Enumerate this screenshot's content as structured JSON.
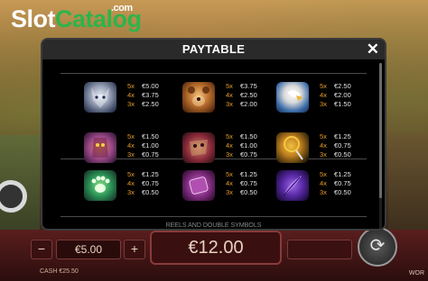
{
  "watermark": {
    "slot": "Slot",
    "catalog": "Catalog",
    "com": ".com"
  },
  "modal": {
    "title": "PAYTABLE",
    "close_label": "✕",
    "footer_text": "REELS AND DOUBLE SYMBOLS"
  },
  "symbols": [
    {
      "icon": "wolf-icon",
      "pays": [
        {
          "mult": "5x",
          "amount": "€5.00"
        },
        {
          "mult": "4x",
          "amount": "€3.75"
        },
        {
          "mult": "3x",
          "amount": "€2.50"
        }
      ]
    },
    {
      "icon": "bear-icon",
      "pays": [
        {
          "mult": "5x",
          "amount": "€3.75"
        },
        {
          "mult": "4x",
          "amount": "€2.50"
        },
        {
          "mult": "3x",
          "amount": "€2.00"
        }
      ]
    },
    {
      "icon": "eagle-icon",
      "pays": [
        {
          "mult": "5x",
          "amount": "€2.50"
        },
        {
          "mult": "4x",
          "amount": "€2.00"
        },
        {
          "mult": "3x",
          "amount": "€1.50"
        }
      ]
    },
    {
      "icon": "totem-icon",
      "pays": [
        {
          "mult": "5x",
          "amount": "€1.50"
        },
        {
          "mult": "4x",
          "amount": "€1.00"
        },
        {
          "mult": "3x",
          "amount": "€0.75"
        }
      ]
    },
    {
      "icon": "mask-icon",
      "pays": [
        {
          "mult": "5x",
          "amount": "€1.50"
        },
        {
          "mult": "4x",
          "amount": "€1.00"
        },
        {
          "mult": "3x",
          "amount": "€0.75"
        }
      ]
    },
    {
      "icon": "dreamcatcher-icon",
      "pays": [
        {
          "mult": "5x",
          "amount": "€1.25"
        },
        {
          "mult": "4x",
          "amount": "€0.75"
        },
        {
          "mult": "3x",
          "amount": "€0.50"
        }
      ]
    },
    {
      "icon": "paw-icon",
      "pays": [
        {
          "mult": "5x",
          "amount": "€1.25"
        },
        {
          "mult": "4x",
          "amount": "€0.75"
        },
        {
          "mult": "3x",
          "amount": "€0.50"
        }
      ]
    },
    {
      "icon": "drum-icon",
      "pays": [
        {
          "mult": "5x",
          "amount": "€1.25"
        },
        {
          "mult": "4x",
          "amount": "€0.75"
        },
        {
          "mult": "3x",
          "amount": "€0.50"
        }
      ]
    },
    {
      "icon": "feather-icon",
      "pays": [
        {
          "mult": "5x",
          "amount": "€1.25"
        },
        {
          "mult": "4x",
          "amount": "€0.75"
        },
        {
          "mult": "3x",
          "amount": "€0.50"
        }
      ]
    }
  ],
  "bottom": {
    "bet_value": "€5.00",
    "minus": "−",
    "plus": "+",
    "win_value": "€12.00",
    "spin_glyph": "⟳",
    "balance_text": "CASH €25.50",
    "corner_text": "WOR"
  }
}
